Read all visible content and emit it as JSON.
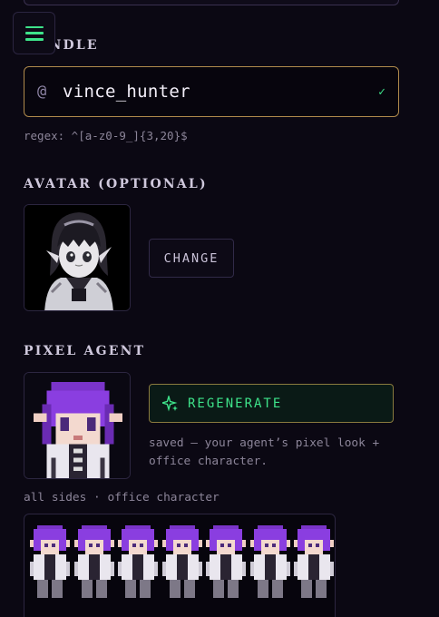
{
  "nav": {
    "menu_icon": "hamburger-menu-icon"
  },
  "handle": {
    "title": "HANDLE",
    "prefix": "@",
    "value": "vince_hunter",
    "valid_mark": "✓",
    "hint": "regex: ^[a-z0-9_]{3,20}$"
  },
  "avatar": {
    "title": "AVATAR (OPTIONAL)",
    "change_label": "CHANGE"
  },
  "pixel_agent": {
    "title": "PIXEL AGENT",
    "regenerate_label": "REGENERATE",
    "regenerate_icon": "sparkles-icon",
    "saved_note": "saved — your agent’s pixel look + office character.",
    "sides_label": "all sides · office character"
  },
  "colors": {
    "accent_green": "#3ee38a",
    "border_gold": "#b08a4c",
    "background": "#0b0813"
  }
}
